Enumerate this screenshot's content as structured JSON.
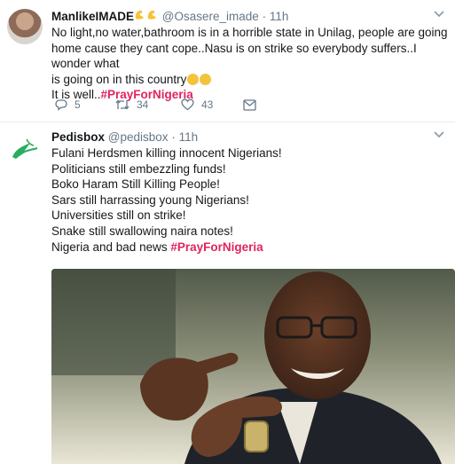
{
  "tweet1": {
    "name": "ManlikeIMADE",
    "handle": "@Osasere_imade",
    "dot": "·",
    "time": "11h",
    "lines": [
      "No light,no water,bathroom is in a horrible state in Unilag, people are going",
      "home cause they cant cope..Nasu is on strike so  everybody suffers..I wonder what",
      "is going on in this country"
    ],
    "last_prefix": "It is well..",
    "hashtag": "#PrayForNigeria",
    "replies": "5",
    "retweets": "34",
    "likes": "43",
    "icons": [
      "flexed-biceps-emoji",
      "crying-face-emoji",
      "reply-icon",
      "retweet-icon",
      "heart-icon",
      "message-icon",
      "chevron-down-icon"
    ]
  },
  "tweet2": {
    "name": "Pedisbox",
    "handle": "@pedisbox",
    "dot": "·",
    "time": "11h",
    "lines": [
      "Fulani Herdsmen killing innocent Nigerians!",
      "Politicians still embezzling funds!",
      "Boko Haram Still Killing People!",
      "Sars still harrassing young Nigerians!",
      "Universities still on strike!",
      "Snake still swallowing naira notes!"
    ],
    "last_prefix": "Nigeria and bad news ",
    "hashtag": "#PrayForNigeria",
    "icons": [
      "pedisbox-logo-icon",
      "chevron-down-icon"
    ]
  },
  "colors": {
    "hashtag": "#e0245e",
    "muted": "#657786",
    "text": "#14171a",
    "divider": "#e6ecf0"
  }
}
